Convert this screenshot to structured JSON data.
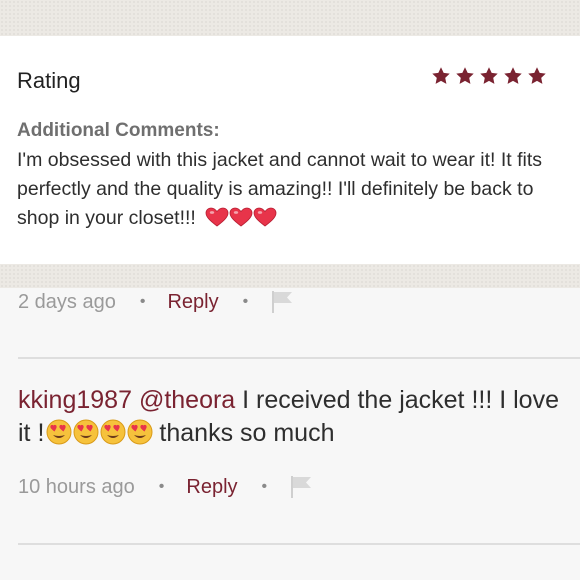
{
  "review": {
    "rating_label": "Rating",
    "rating_value": 5,
    "rating_max": 5,
    "additional_comments_title": "Additional Comments:",
    "comment_text": "I'm obsessed with this jacket and cannot wait to wear it! It fits perfectly and the quality is amazing!! I'll definitely be back to shop in your closet!!!",
    "trailing_emoji": [
      "heart-emoji",
      "heart-emoji",
      "heart-emoji"
    ]
  },
  "review_meta": {
    "time_ago": "2 days ago",
    "separator": "•",
    "reply_label": "Reply",
    "flag_icon": "flag-icon"
  },
  "comments": [
    {
      "username": "kking1987",
      "mention": "@theora",
      "text_before_emoji": "I received the jacket !!! I love it !",
      "emoji": [
        "heart-eyes-emoji",
        "heart-eyes-emoji",
        "heart-eyes-emoji",
        "heart-eyes-emoji"
      ],
      "text_after_emoji": "thanks so much",
      "time_ago": "10 hours ago",
      "reply_label": "Reply",
      "separator": "•"
    }
  ],
  "colors": {
    "accent": "#7a2331",
    "star": "#7a2331",
    "muted_text": "#9a9a9a",
    "heading_gray": "#6f6f6f",
    "band": "#ece9e4",
    "card_bg": "#ffffff",
    "page_bg": "#f7f7f7"
  }
}
